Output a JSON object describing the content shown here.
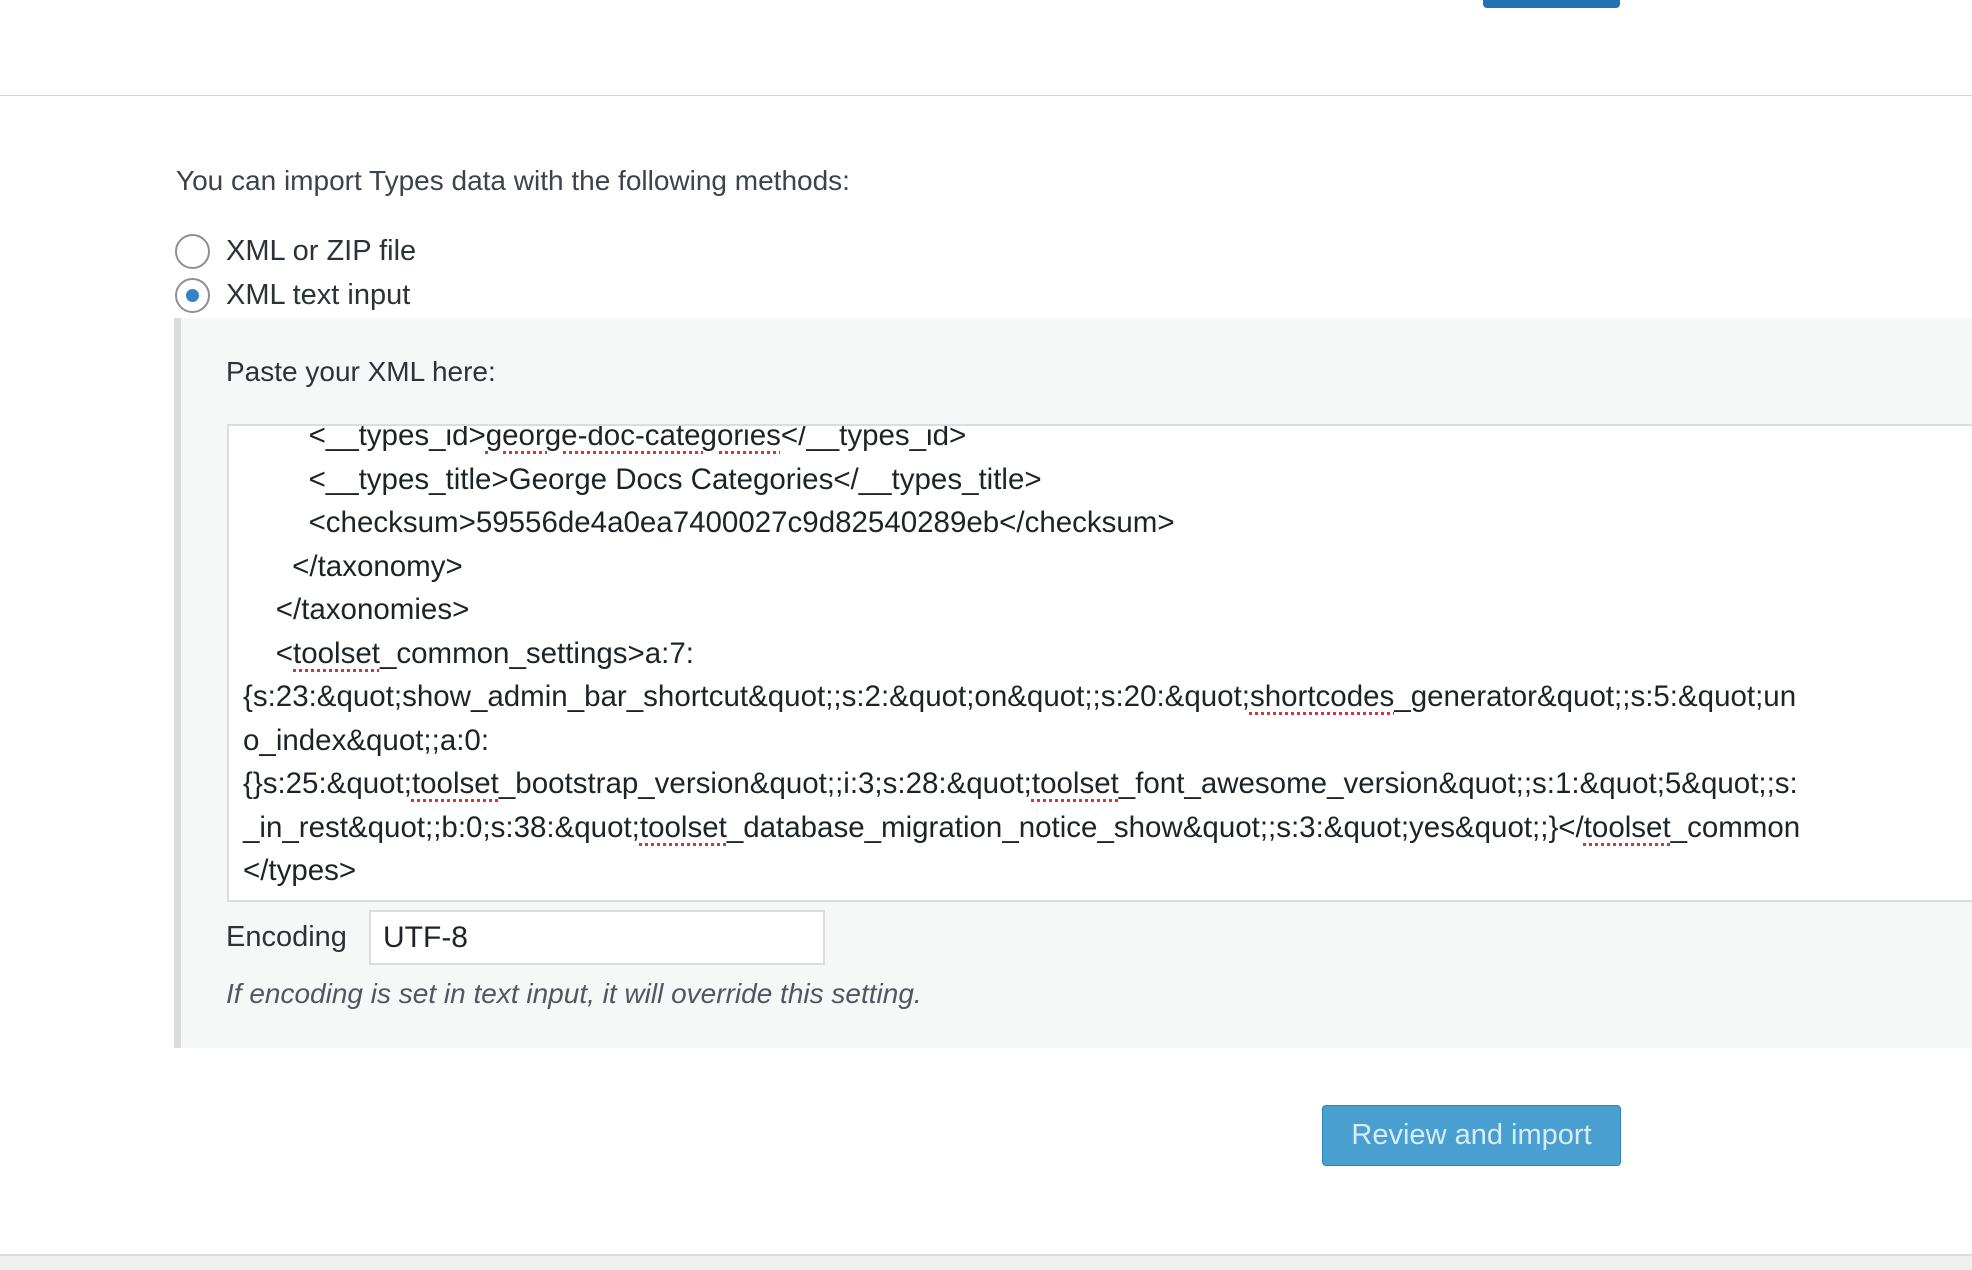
{
  "intro_text": "You can import Types data with the following methods:",
  "import_methods": [
    {
      "label": "XML or ZIP file",
      "checked": false
    },
    {
      "label": "XML text input",
      "checked": true
    }
  ],
  "paste_label": "Paste your XML here:",
  "xml_lines": [
    [
      {
        "t": "        <__types_id>"
      },
      {
        "t": "george-doc-categories",
        "spell": true
      },
      {
        "t": "</__types_id>"
      }
    ],
    [
      {
        "t": "        <__types_title>George Docs Categories</__types_title>"
      }
    ],
    [
      {
        "t": "        <checksum>59556de4a0ea7400027c9d82540289eb</checksum>"
      }
    ],
    [
      {
        "t": "      </taxonomy>"
      }
    ],
    [
      {
        "t": "    </taxonomies>"
      }
    ],
    [
      {
        "t": "    <"
      },
      {
        "t": "toolset",
        "spell": true
      },
      {
        "t": "_common_settings>a:7:"
      }
    ],
    [
      {
        "t": "{s:23:&quot;show_admin_bar_shortcut&quot;;s:2:&quot;on&quot;;s:20:&quot;"
      },
      {
        "t": "shortcodes",
        "spell": true
      },
      {
        "t": "_generator&quot;;s:5:&quot;un"
      }
    ],
    [
      {
        "t": "o_index&quot;;a:0:"
      }
    ],
    [
      {
        "t": "{}s:25:&quot;"
      },
      {
        "t": "toolset",
        "spell": true
      },
      {
        "t": "_bootstrap_version&quot;;i:3;s:28:&quot;"
      },
      {
        "t": "toolset",
        "spell": true
      },
      {
        "t": "_font_awesome_version&quot;;s:1:&quot;5&quot;;s:"
      }
    ],
    [
      {
        "t": "_in_rest&quot;;b:0;s:38:&quot;"
      },
      {
        "t": "toolset",
        "spell": true
      },
      {
        "t": "_database_migration_notice_show&quot;;s:3:&quot;yes&quot;;}</"
      },
      {
        "t": "toolset",
        "spell": true
      },
      {
        "t": "_common"
      }
    ],
    [
      {
        "t": "</types>"
      }
    ]
  ],
  "encoding": {
    "label": "Encoding",
    "value": "UTF-8",
    "note": "If encoding is set in text input, it will override this setting."
  },
  "review_button_label": "Review and import",
  "colors": {
    "accent": "#2271b1",
    "review_button": "#4a9fd1",
    "radio_checked": "#3582c4",
    "spellcheck": "#d63638"
  }
}
